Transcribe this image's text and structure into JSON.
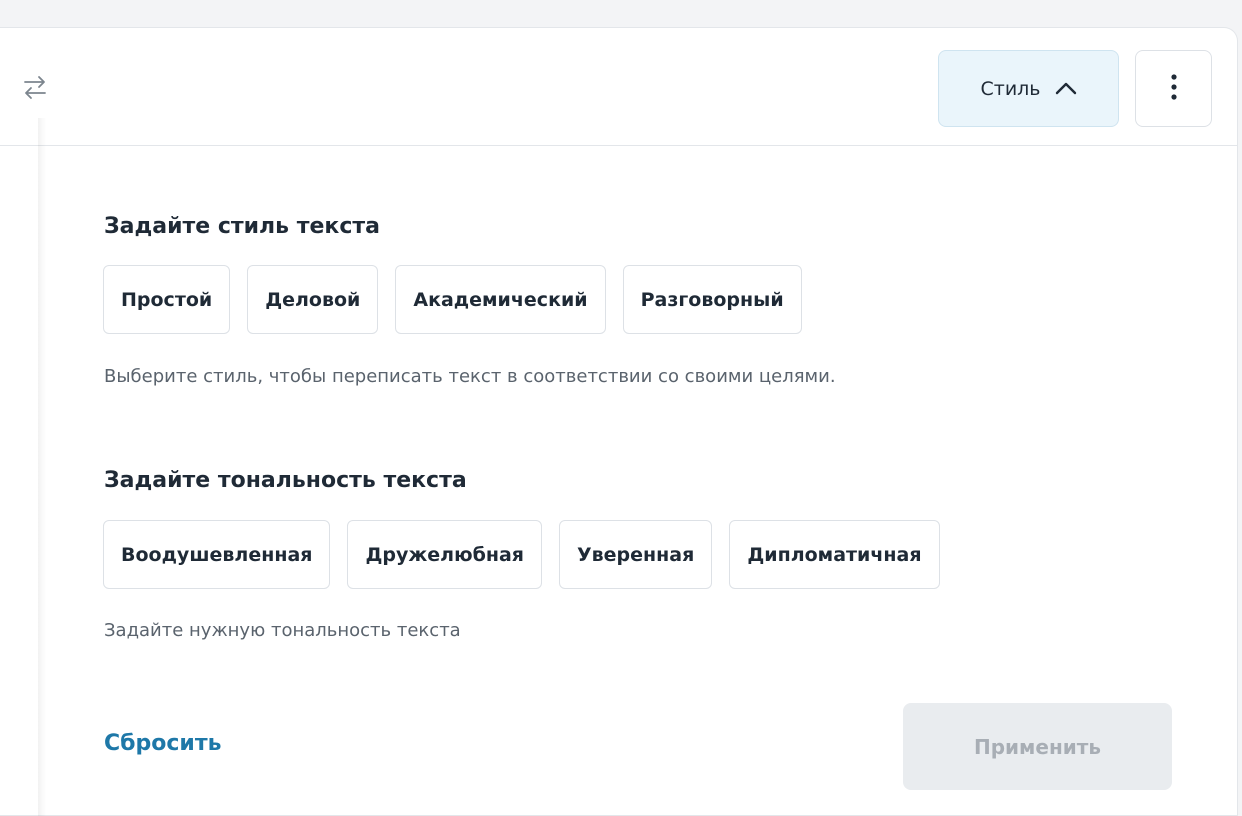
{
  "toolbar": {
    "swap_icon": "swap-arrows-icon",
    "style_label": "Стиль",
    "style_chevron_icon": "chevron-up-icon",
    "more_icon": "more-vertical-icon"
  },
  "style_section": {
    "title": "Задайте стиль текста",
    "options": [
      "Простой",
      "Деловой",
      "Академический",
      "Разговорный"
    ],
    "hint": "Выберите стиль, чтобы переписать текст в соответствии со своими целями."
  },
  "tone_section": {
    "title": "Задайте тональность текста",
    "options": [
      "Воодушевленная",
      "Дружелюбная",
      "Уверенная",
      "Дипломатичная"
    ],
    "hint": "Задайте нужную тональность текста"
  },
  "footer": {
    "reset_label": "Сбросить",
    "apply_label": "Применить"
  },
  "colors": {
    "accent_link": "#1e78a8",
    "style_button_bg": "#eaf5fb",
    "apply_disabled_bg": "#e9ecef"
  }
}
